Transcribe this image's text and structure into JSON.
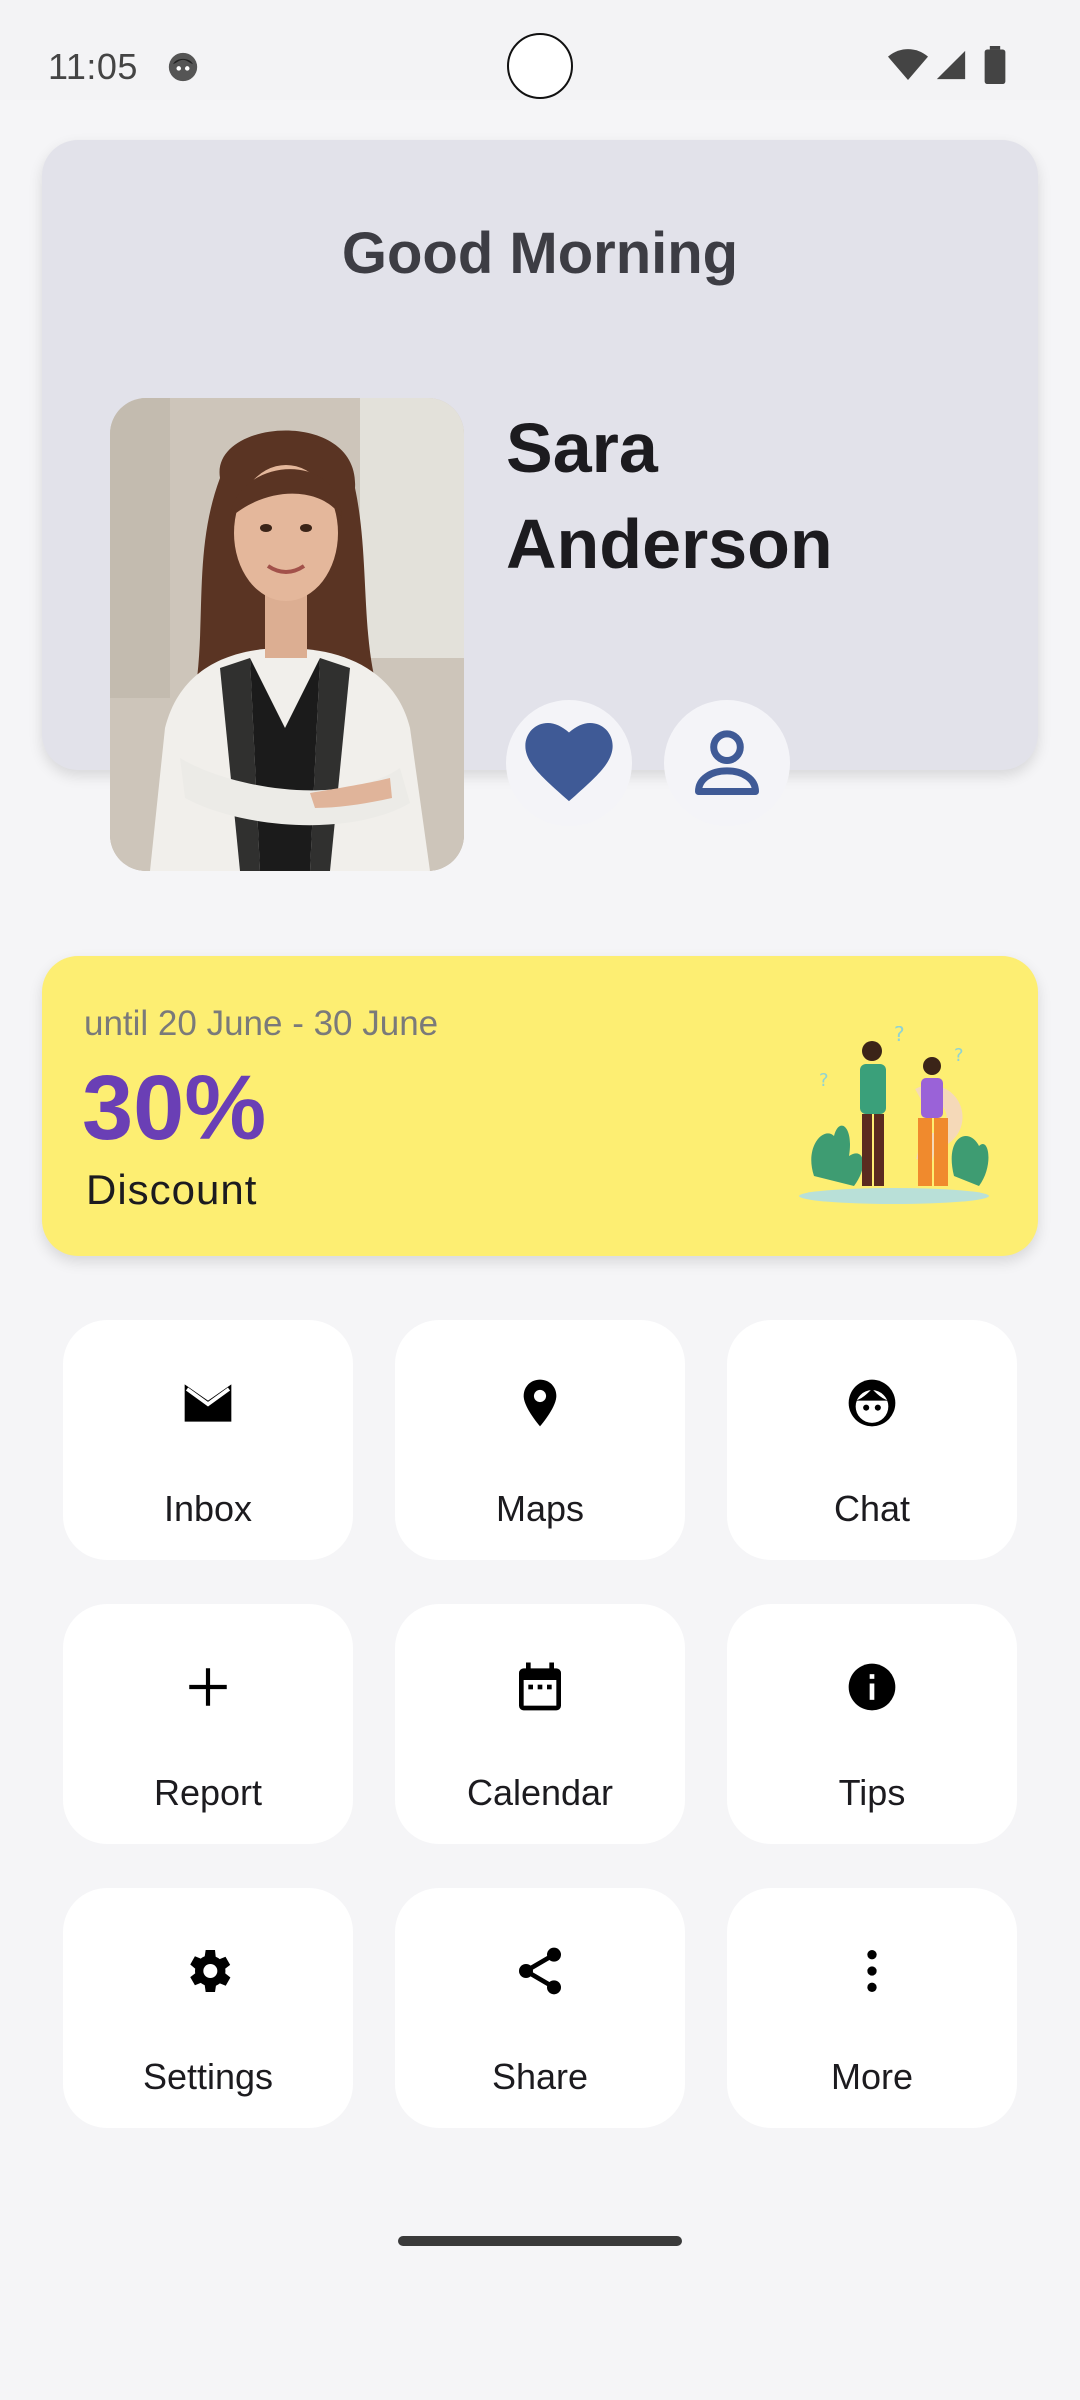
{
  "status_bar": {
    "time": "11:05",
    "icons": [
      "notification-face-icon",
      "wifi-icon",
      "signal-icon",
      "battery-icon"
    ]
  },
  "greeting": {
    "title": "Good Morning",
    "first_name": "Sara",
    "last_name": "Anderson",
    "photo_icon": "profile-photo",
    "buttons": [
      {
        "icon": "heart-icon",
        "color": "#3f5a96"
      },
      {
        "icon": "person-icon",
        "color": "#3f5a96"
      }
    ]
  },
  "promo": {
    "dates": "until 20 June - 30 June",
    "percent": "30%",
    "label": "Discount",
    "background": "#fdee72",
    "accent": "#6a3fb5",
    "illustration": "people-question-illustration"
  },
  "menu": [
    {
      "label": "Inbox",
      "icon": "mail-icon"
    },
    {
      "label": "Maps",
      "icon": "location-pin-icon"
    },
    {
      "label": "Chat",
      "icon": "face-icon"
    },
    {
      "label": "Report",
      "icon": "plus-icon"
    },
    {
      "label": "Calendar",
      "icon": "calendar-icon"
    },
    {
      "label": "Tips",
      "icon": "info-icon"
    },
    {
      "label": "Settings",
      "icon": "gear-icon"
    },
    {
      "label": "Share",
      "icon": "share-icon"
    },
    {
      "label": "More",
      "icon": "more-vertical-icon"
    }
  ]
}
